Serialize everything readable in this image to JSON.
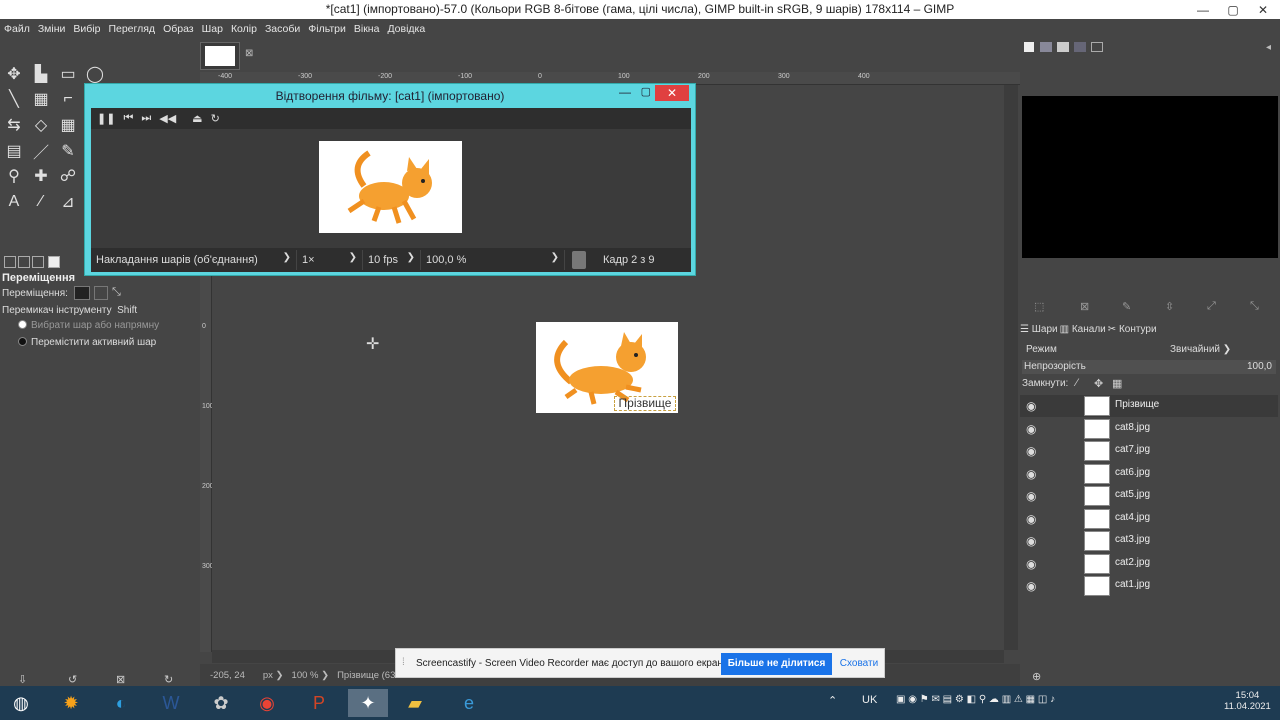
{
  "window": {
    "title": "*[cat1] (імпортовано)-57.0 (Кольори RGB 8-бітове (гама, цілі числа), GIMP built-in sRGB, 9 шарів) 178x114 – GIMP",
    "min": "—",
    "max": "▢",
    "close": "✕"
  },
  "menu": [
    "Файл",
    "Зміни",
    "Вибір",
    "Перегляд",
    "Образ",
    "Шар",
    "Колір",
    "Засоби",
    "Фільтри",
    "Вікна",
    "Довідка"
  ],
  "tool_options": {
    "title": "Переміщення",
    "row1_label": "Переміщення:",
    "row2_label": "Перемикач інструменту",
    "row2_value": "Shift",
    "radio1": "Вибрати шар або напрямну",
    "radio2": "Перемістити активний шар"
  },
  "ruler": {
    "top_labels": [
      "-400",
      "-300",
      "-200",
      "-100",
      "0",
      "100",
      "200",
      "300",
      "400"
    ],
    "left_labels": [
      "0",
      "100",
      "200",
      "300"
    ]
  },
  "canvas_text": "Прізвище",
  "playback": {
    "title": "Відтворення фільму: [cat1] (імпортовано)",
    "mode": "Накладання шарів (об'єднання)",
    "speed": "1×",
    "fps": "10 fps",
    "zoom": "100,0 %",
    "frame": "Кадр 2 з 9"
  },
  "layers_panel": {
    "tabs": [
      "Шари",
      "Канали",
      "Контури"
    ],
    "mode_label": "Режим",
    "mode_value": "Звичайний",
    "opacity_label": "Непрозорість",
    "opacity_value": "100,0",
    "lock_label": "Замкнути:",
    "layers": [
      "Прізвище",
      "cat8.jpg",
      "cat7.jpg",
      "cat6.jpg",
      "cat5.jpg",
      "cat4.jpg",
      "cat3.jpg",
      "cat2.jpg",
      "cat1.jpg"
    ]
  },
  "status": {
    "coords": "-205, 24",
    "unit": "px",
    "zoom": "100 %",
    "layer": "Прізвище (63"
  },
  "notification": {
    "message": "Screencastify - Screen Video Recorder має доступ до вашого екрана.",
    "primary": "Більше не ділитися",
    "secondary": "Сховати"
  },
  "tray": {
    "lang": "UK",
    "time": "15:04",
    "date": "11.04.2021"
  }
}
